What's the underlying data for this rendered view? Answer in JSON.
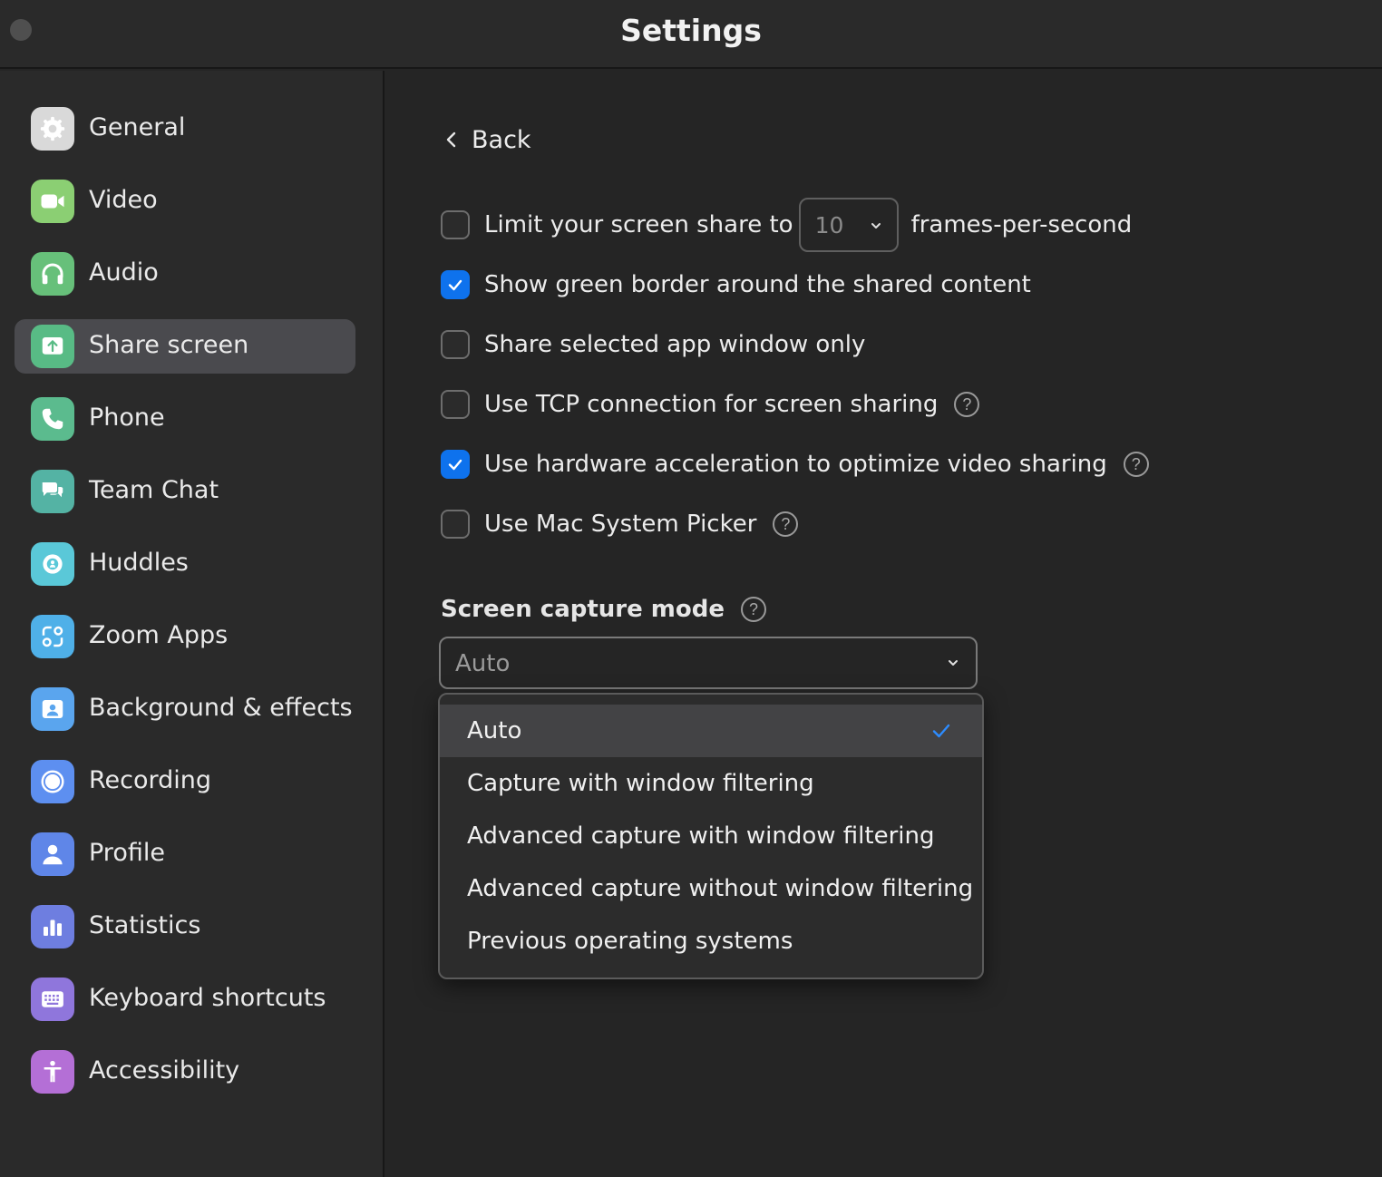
{
  "window": {
    "title": "Settings"
  },
  "sidebar": {
    "items": [
      {
        "label": "General",
        "icon": "gear-icon",
        "color": "#d9d9d9"
      },
      {
        "label": "Video",
        "icon": "video-camera-icon",
        "color": "#8bcf73"
      },
      {
        "label": "Audio",
        "icon": "headphones-icon",
        "color": "#67c07a"
      },
      {
        "label": "Share screen",
        "icon": "share-screen-icon",
        "color": "#58bb85",
        "active": true
      },
      {
        "label": "Phone",
        "icon": "phone-icon",
        "color": "#5bbb8e"
      },
      {
        "label": "Team Chat",
        "icon": "chat-bubbles-icon",
        "color": "#54b3a4"
      },
      {
        "label": "Huddles",
        "icon": "huddles-icon",
        "color": "#5ac8d8"
      },
      {
        "label": "Zoom Apps",
        "icon": "apps-icon",
        "color": "#4fb0e8"
      },
      {
        "label": "Background & effects",
        "icon": "background-person-icon",
        "color": "#5aa5ee"
      },
      {
        "label": "Recording",
        "icon": "record-icon",
        "color": "#5d8ff0"
      },
      {
        "label": "Profile",
        "icon": "profile-person-icon",
        "color": "#5f86e8"
      },
      {
        "label": "Statistics",
        "icon": "bar-chart-icon",
        "color": "#6e7ee0"
      },
      {
        "label": "Keyboard shortcuts",
        "icon": "keyboard-icon",
        "color": "#8f76dc"
      },
      {
        "label": "Accessibility",
        "icon": "accessibility-icon",
        "color": "#b46fd6"
      }
    ]
  },
  "content": {
    "back_label": "Back",
    "options": {
      "limit_fps": {
        "label": "Limit your screen share to",
        "checked": false,
        "fps_value": "10",
        "suffix": "frames-per-second"
      },
      "green_border": {
        "label": "Show green border around the shared content",
        "checked": true
      },
      "selected_app": {
        "label": "Share selected app window only",
        "checked": false
      },
      "tcp": {
        "label": "Use TCP connection for screen sharing",
        "checked": false,
        "help": "?"
      },
      "hw_accel": {
        "label": "Use hardware acceleration to optimize video sharing",
        "checked": true,
        "help": "?"
      },
      "mac_picker": {
        "label": "Use Mac System Picker",
        "checked": false,
        "help": "?"
      }
    },
    "capture_mode": {
      "title": "Screen capture mode",
      "help": "?",
      "selected": "Auto",
      "options": [
        "Auto",
        "Capture with window filtering",
        "Advanced capture with window filtering",
        "Advanced capture without window filtering",
        "Previous operating systems"
      ]
    }
  },
  "colors": {
    "accent": "#0e72ed",
    "active_nav": "#4a4a4e"
  }
}
